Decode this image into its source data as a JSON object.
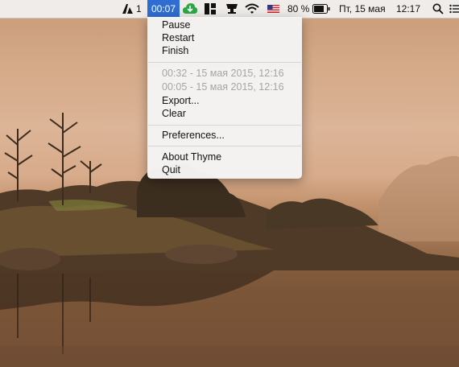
{
  "menubar": {
    "adobe_count": "1",
    "timer_value": "00:07",
    "battery_percent": "80 %",
    "date": "Пт, 15 мая",
    "time": "12:17"
  },
  "timer_menu": {
    "pause": "Pause",
    "restart": "Restart",
    "finish": "Finish",
    "history": [
      "00:32 - 15 мая 2015, 12:16",
      "00:05 - 15 мая 2015, 12:16"
    ],
    "export": "Export...",
    "clear": "Clear",
    "preferences": "Preferences...",
    "about": "About Thyme",
    "quit": "Quit"
  },
  "colors": {
    "timer_highlight": "#2f6dd2",
    "menu_bg": "#f4f3f2",
    "disabled_text": "#a7a5a3"
  },
  "icons": [
    "adobe-icon",
    "cloud-sync-icon",
    "window-layout-icon",
    "drive-icon",
    "wifi-icon",
    "us-flag-icon",
    "battery-icon",
    "search-icon",
    "notification-list-icon"
  ]
}
